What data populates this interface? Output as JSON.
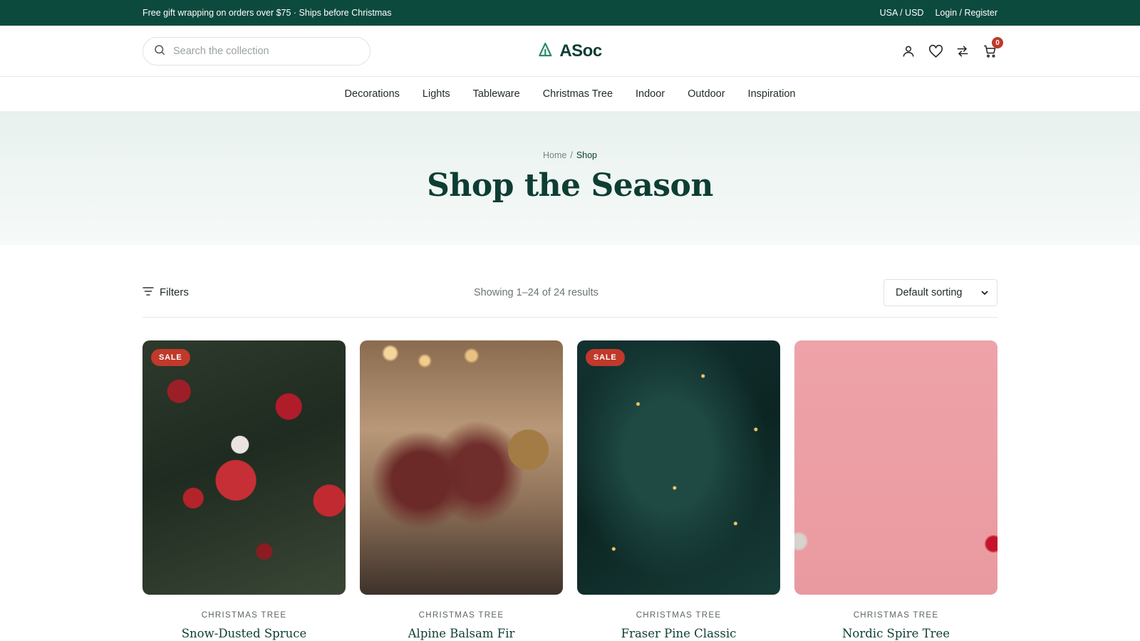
{
  "topbar": {
    "promo": "Free gift wrapping on orders over $75 · Ships before Christmas",
    "currency": "USA / USD",
    "login": "Login / Register"
  },
  "header": {
    "search_placeholder": "Search the collection",
    "logo": "ASoc",
    "cart_count": "0",
    "icons": [
      "user-icon",
      "heart-icon",
      "compare-icon",
      "cart-icon"
    ]
  },
  "nav": [
    "Decorations",
    "Lights",
    "Tableware",
    "Christmas Tree",
    "Indoor",
    "Outdoor",
    "Inspiration"
  ],
  "hero": {
    "breadcrumb_home": "Home",
    "breadcrumb_sep": "/",
    "breadcrumb_current": "Shop",
    "title": "Shop the Season"
  },
  "toolbar": {
    "filters_label": "Filters",
    "results_text": "Showing 1–24 of 24 results",
    "sort_label": "Default sorting"
  },
  "products": [
    {
      "category": "CHRISTMAS TREE",
      "name": "Snow-Dusted Spruce",
      "badge": "SALE"
    },
    {
      "category": "CHRISTMAS TREE",
      "name": "Alpine Balsam Fir",
      "badge": ""
    },
    {
      "category": "CHRISTMAS TREE",
      "name": "Fraser Pine Classic",
      "badge": "SALE"
    },
    {
      "category": "CHRISTMAS TREE",
      "name": "Nordic Spire Tree",
      "badge": ""
    }
  ],
  "colors": {
    "brand_green": "#0d4a3e",
    "sale_red": "#c0392b"
  }
}
